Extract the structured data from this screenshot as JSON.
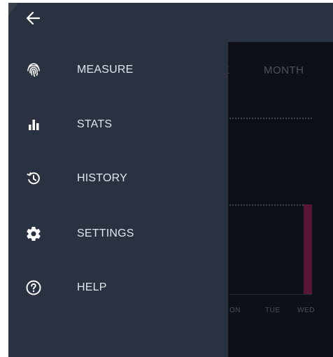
{
  "drawer": {
    "back_icon": "arrow-left-icon",
    "items": [
      {
        "label": "MEASURE",
        "icon": "fingerprint-icon"
      },
      {
        "label": "STATS",
        "icon": "bar-chart-icon"
      },
      {
        "label": "HISTORY",
        "icon": "history-icon"
      },
      {
        "label": "SETTINGS",
        "icon": "gear-icon"
      },
      {
        "label": "HELP",
        "icon": "help-circle-icon"
      }
    ]
  },
  "background": {
    "tabs": [
      "K",
      "MONTH"
    ],
    "days": [
      "ON",
      "TUE",
      "WED"
    ],
    "bar_values": [
      0,
      0,
      1
    ]
  },
  "colors": {
    "drawer_bg": "#2a3242",
    "accent": "#8e1b47",
    "bar": "#5a1535",
    "text": "#e2e5ea"
  }
}
